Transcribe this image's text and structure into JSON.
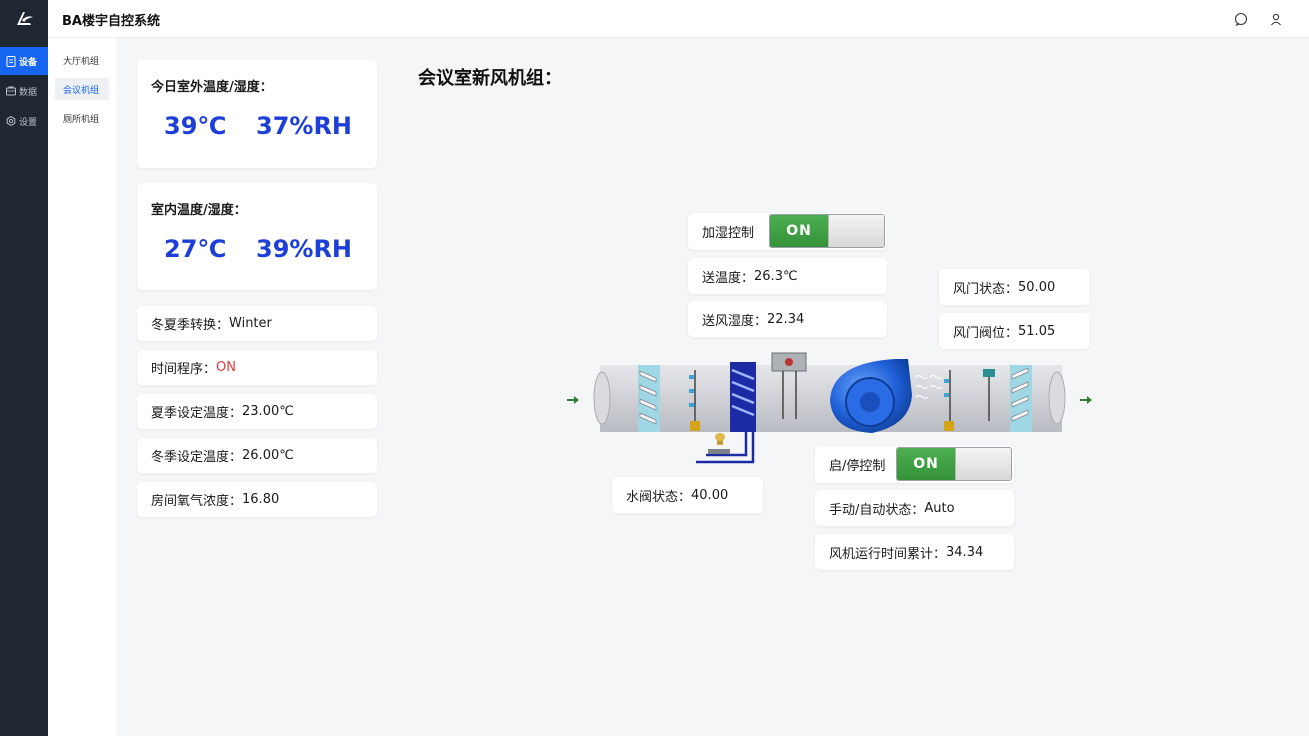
{
  "app": {
    "title": "BA楼宇自控系统"
  },
  "header": {
    "icons": [
      "message-icon",
      "user-icon"
    ]
  },
  "rail": {
    "items": [
      {
        "label": "设备",
        "icon": "device-icon",
        "active": true
      },
      {
        "label": "数据",
        "icon": "data-icon",
        "active": false
      },
      {
        "label": "设置",
        "icon": "settings-icon",
        "active": false
      }
    ]
  },
  "subnav": {
    "items": [
      {
        "label": "大厅机组",
        "active": false
      },
      {
        "label": "会议机组",
        "active": true
      },
      {
        "label": "厕所机组",
        "active": false
      }
    ]
  },
  "outdoor": {
    "title": "今日室外温度/湿度：",
    "temp": "39℃",
    "humidity": "37%RH"
  },
  "indoor": {
    "title": "室内温度/湿度：",
    "temp": "27℃",
    "humidity": "39%RH"
  },
  "status_rows": {
    "season": {
      "label": "冬夏季转换：",
      "value": "Winter"
    },
    "schedule": {
      "label": "时间程序：",
      "value": "ON"
    },
    "summer_set": {
      "label": "夏季设定温度：",
      "value": "23.00℃"
    },
    "winter_set": {
      "label": "冬季设定温度：",
      "value": "26.00℃"
    },
    "oxygen": {
      "label": "房间氧气浓度：",
      "value": "16.80"
    }
  },
  "unit": {
    "title": "会议室新风机组：",
    "humidify": {
      "label": "加湿控制",
      "toggle": "ON"
    },
    "supply_temp": {
      "label": "送温度：",
      "value": "26.3℃"
    },
    "supply_humidity": {
      "label": "送风湿度：",
      "value": "22.34"
    },
    "damper_state": {
      "label": "风门状态：",
      "value": "50.00"
    },
    "damper_pos": {
      "label": "风门阀位：",
      "value": "51.05"
    },
    "water_valve": {
      "label": "水阀状态：",
      "value": "40.00"
    },
    "start_stop": {
      "label": "启/停控制",
      "toggle": "ON"
    },
    "mode": {
      "label": "手动/自动状态：",
      "value": "Auto"
    },
    "runtime": {
      "label": "风机运行时间累计：",
      "value": "34.34"
    }
  },
  "colors": {
    "accent": "#1765f3",
    "value_blue": "#1d3fd8",
    "on_green": "#3fa345",
    "alert_red": "#e03a3a",
    "sidebar": "#1f2733"
  }
}
